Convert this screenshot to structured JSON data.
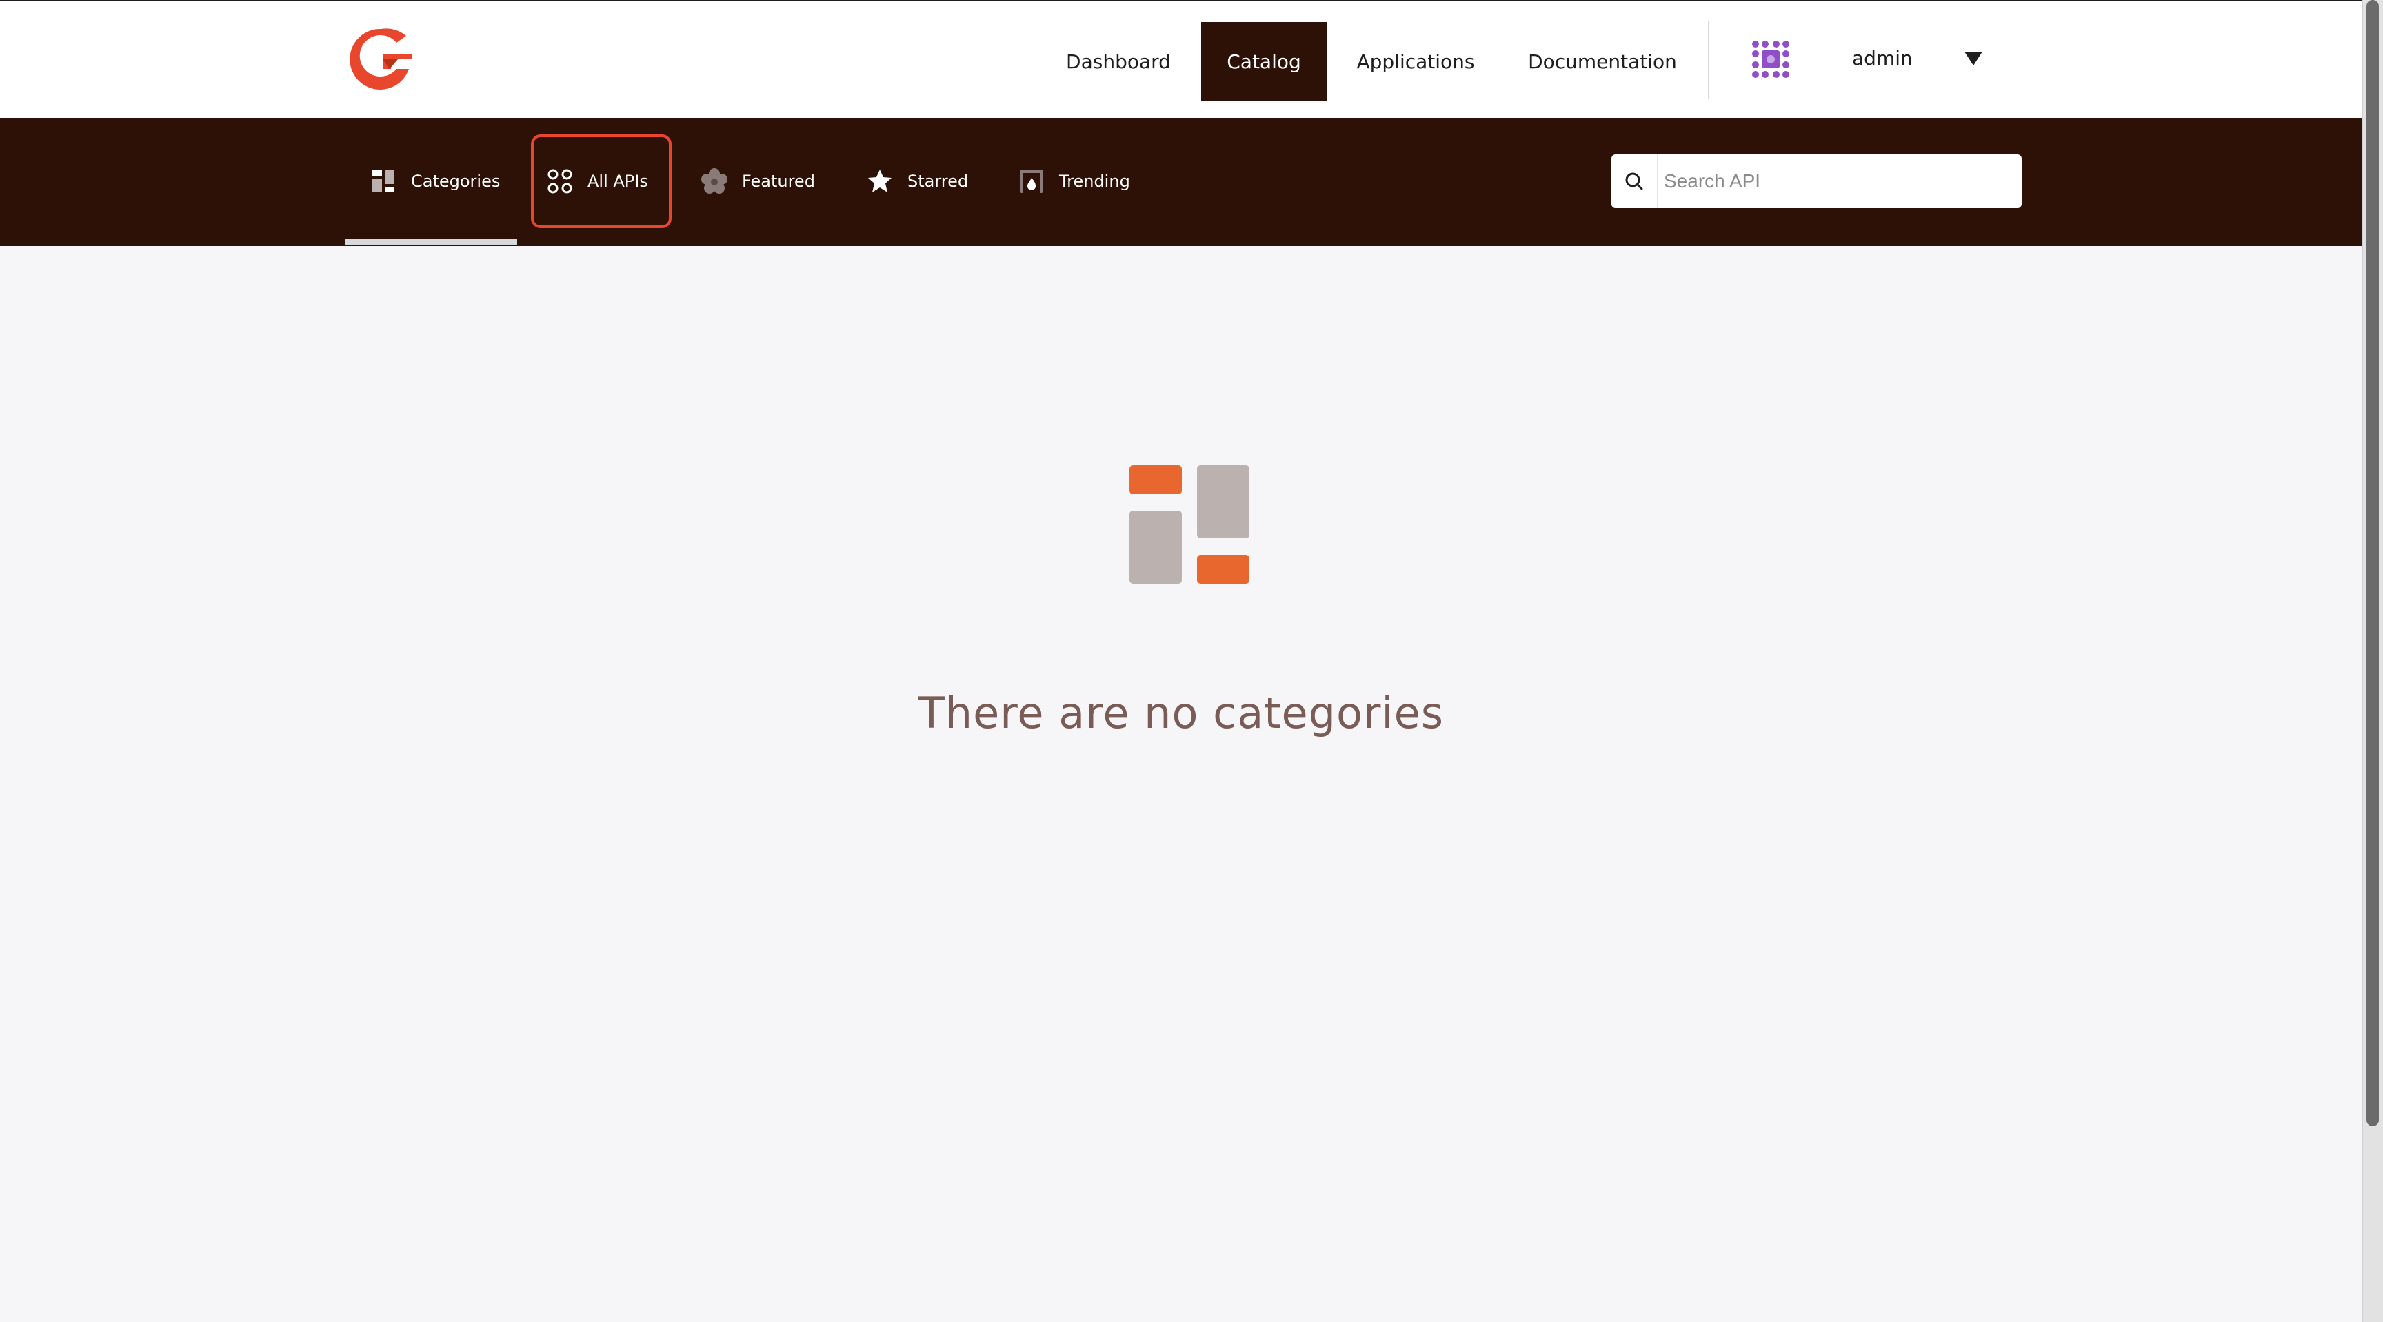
{
  "header": {
    "logo_name": "gravitee-logo",
    "nav": [
      {
        "label": "Dashboard",
        "active": false
      },
      {
        "label": "Catalog",
        "active": true
      },
      {
        "label": "Applications",
        "active": false
      },
      {
        "label": "Documentation",
        "active": false
      }
    ],
    "user": {
      "name": "admin",
      "avatar_icon": "identicon-avatar"
    }
  },
  "subnav": {
    "items": [
      {
        "label": "Categories",
        "icon": "categories-icon",
        "active": true
      },
      {
        "label": "All APIs",
        "icon": "all-apis-icon",
        "focused": true
      },
      {
        "label": "Featured",
        "icon": "featured-icon"
      },
      {
        "label": "Starred",
        "icon": "star-icon"
      },
      {
        "label": "Trending",
        "icon": "trending-icon"
      }
    ],
    "search": {
      "placeholder": "Search API",
      "value": ""
    }
  },
  "main": {
    "empty_state": {
      "icon": "categories-illustration",
      "message": "There are no categories"
    }
  },
  "colors": {
    "brand_dark": "#2d1106",
    "accent": "#e8472e",
    "illustration_orange": "#e8672e",
    "illustration_gray": "#bbb2b0",
    "empty_text": "#7a5c56"
  }
}
